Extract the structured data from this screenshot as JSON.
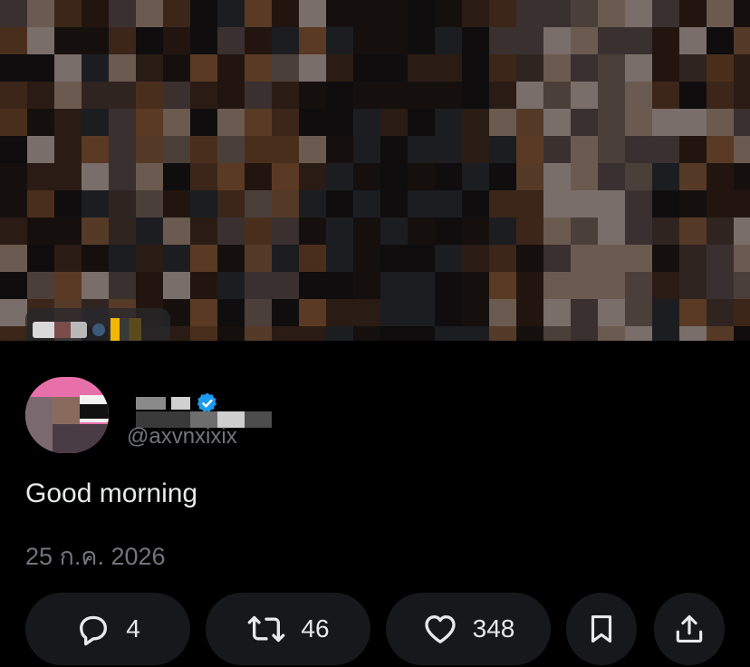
{
  "author": {
    "handle": "@axvnxixix"
  },
  "tweet": {
    "text": "Good morning",
    "timestamp": "25 ก.ค. 2026"
  },
  "actions": {
    "reply_count": "4",
    "retweet_count": "46",
    "like_count": "348"
  },
  "icons": {
    "reply": "speech-bubble-icon",
    "retweet": "retweet-icon",
    "like": "heart-icon",
    "bookmark": "bookmark-icon",
    "share": "share-icon",
    "verified": "verified-badge-icon"
  },
  "colors": {
    "background": "#000000",
    "text": "#e7e9ea",
    "muted": "#71767b",
    "pill": "#16181c",
    "verified": "#1d9bf0"
  }
}
